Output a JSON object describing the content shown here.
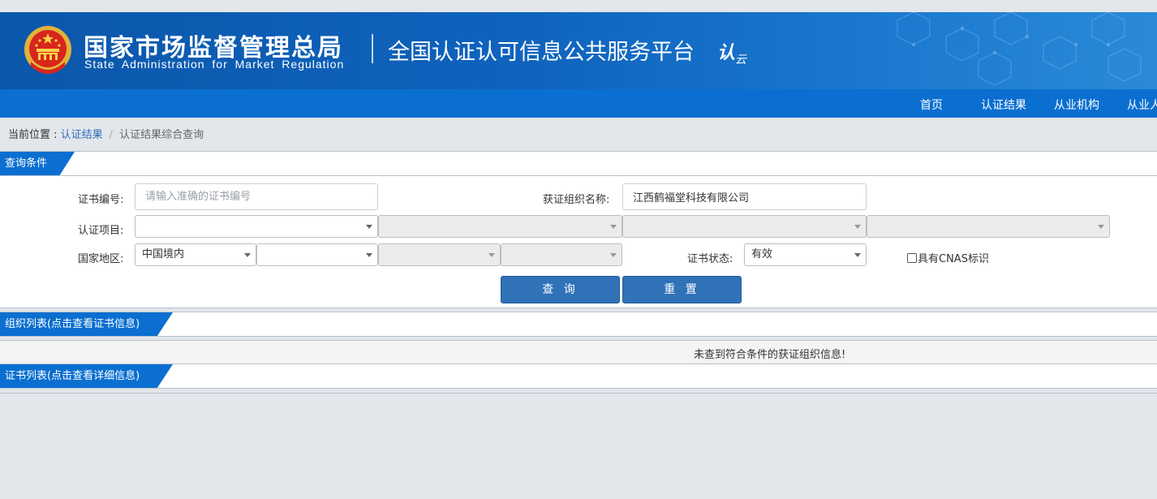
{
  "header": {
    "org_name_cn": "国家市场监督管理总局",
    "org_name_en": "State Administration for Market Regulation",
    "platform_name": "全国认证认可信息公共服务平台",
    "logo_text_main": "认",
    "logo_text_sub": "云"
  },
  "nav": {
    "items": [
      "首页",
      "认证结果",
      "从业机构",
      "从业人"
    ]
  },
  "breadcrumb": {
    "prefix": "当前位置 : ",
    "link": "认证结果",
    "separator": "/",
    "current": "认证结果综合查询"
  },
  "query_section": {
    "title": "查询条件",
    "cert_no_label": "证书编号:",
    "cert_no_placeholder": "请输入准确的证书编号",
    "cert_no_value": "",
    "org_name_label": "获证组织名称:",
    "org_name_value": "江西鹤福堂科技有限公司",
    "project_label": "认证项目:",
    "project_selects": [
      "",
      "",
      "",
      ""
    ],
    "region_label": "国家地区:",
    "region_selects": [
      "中国境内",
      "",
      "",
      ""
    ],
    "status_label": "证书状态:",
    "status_value": "有效",
    "cnas_label": "具有CNAS标识",
    "search_button": "查 询",
    "reset_button": "重 置"
  },
  "org_list": {
    "title": "组织列表(点击查看证书信息)",
    "empty_message": "未查到符合条件的获证组织信息!"
  },
  "cert_list": {
    "title": "证书列表(点击查看详细信息)"
  },
  "colors": {
    "banner_blue": "#0f63bd",
    "nav_blue": "#0a6fd0",
    "button_blue": "#2f72b8",
    "link_blue": "#2a6fbd",
    "page_bg": "#e3e6ea"
  }
}
